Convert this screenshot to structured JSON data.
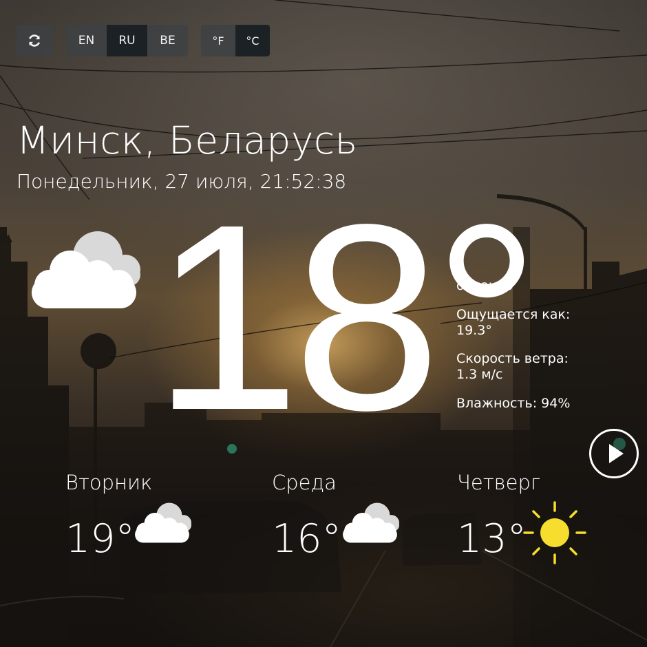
{
  "toolbar": {
    "refresh_icon": "refresh-icon",
    "languages": [
      "EN",
      "RU",
      "BE"
    ],
    "active_language": "RU",
    "units": [
      "°F",
      "°C"
    ],
    "active_unit": "°C"
  },
  "location": {
    "city": "Минск, Беларусь",
    "datetime": "Понедельник, 27 июля, 21:52:38"
  },
  "current": {
    "temperature": "18°",
    "icon": "cloudy-icon",
    "condition": "облачно",
    "feels_like_label": "Ощущается как:",
    "feels_like_value": "19.3°",
    "wind_label": "Скорость ветра:",
    "wind_value": "1.3 м/с",
    "humidity": "Влажность: 94%"
  },
  "controls": {
    "play_icon": "play-icon"
  },
  "forecast": [
    {
      "day": "Вторник",
      "temp": "19°",
      "icon": "cloudy-icon"
    },
    {
      "day": "Среда",
      "temp": "16°",
      "icon": "cloudy-icon"
    },
    {
      "day": "Четверг",
      "temp": "13°",
      "icon": "sun-icon"
    }
  ],
  "colors": {
    "sun": "#f7dd2e",
    "cloud_front": "#ffffff",
    "cloud_back": "#d9d9d9",
    "button_bg": "#3c4044",
    "button_active_bg": "#181e22"
  }
}
